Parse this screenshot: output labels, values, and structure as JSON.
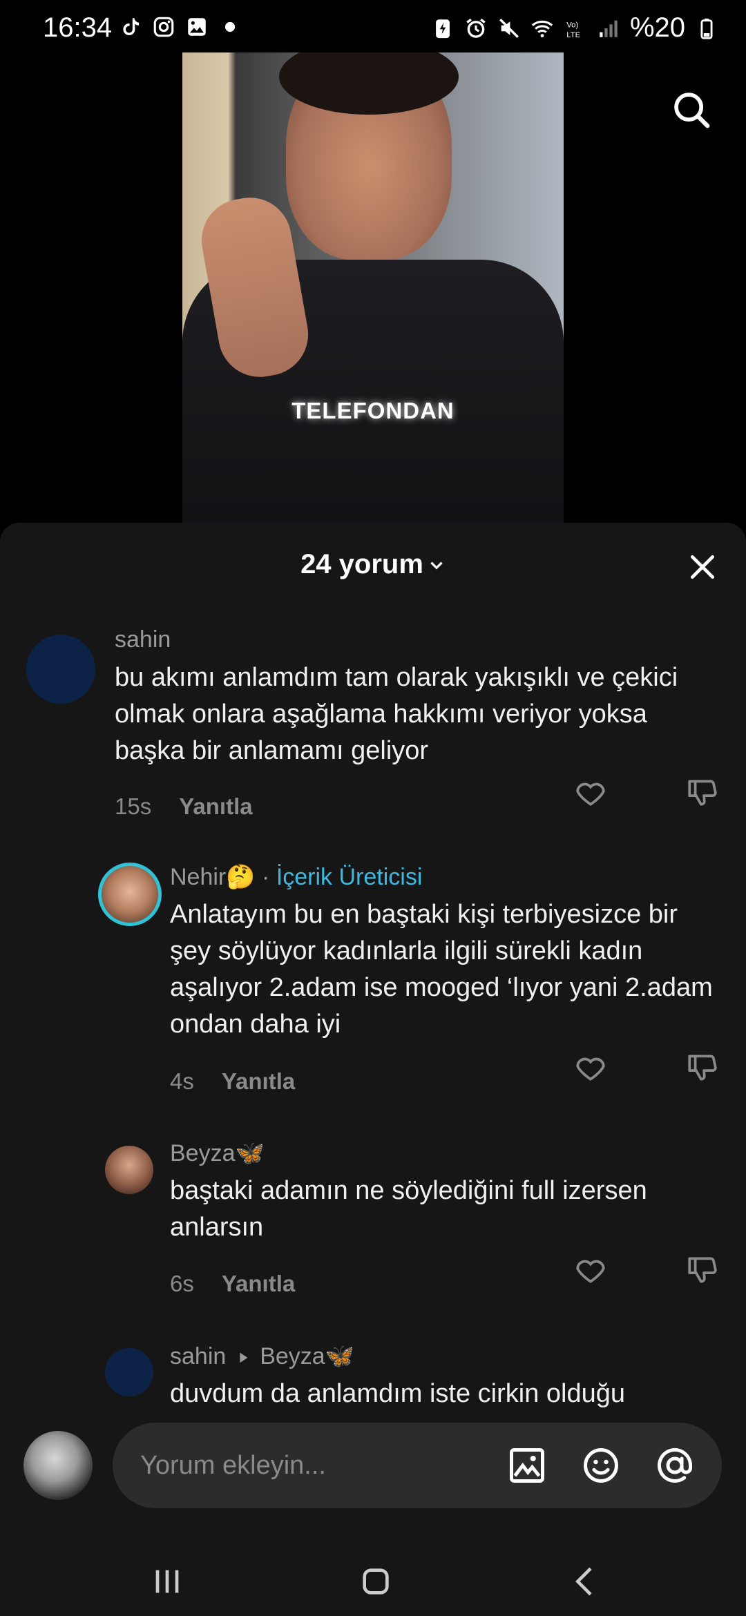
{
  "status_bar": {
    "time": "16:34",
    "battery": "%20",
    "left_icons": [
      "tiktok-icon",
      "instagram-icon",
      "gallery-icon",
      "dot-icon"
    ],
    "right_icons": [
      "battery-saver-icon",
      "alarm-icon",
      "mute-icon",
      "wifi-icon",
      "volte-icon",
      "signal-icon",
      "battery-icon"
    ]
  },
  "video": {
    "caption": "TELEFONDAN"
  },
  "sheet": {
    "title": "24 yorum"
  },
  "comments": [
    {
      "user": "sahin",
      "badge": "",
      "text": "bu akımı anlamdım tam olarak yakışıklı ve çekici olmak onlara aşağlama hakkımı veriyor yoksa başka bir anlamamı geliyor",
      "time": "15s",
      "reply_label": "Yanıtla"
    },
    {
      "user": "Nehir🤔",
      "separator": " · ",
      "badge": "İçerik Üreticisi",
      "text": "Anlatayım bu en baştaki kişi terbiyesizce bir şey söylüyor kadınlarla ilgili sürekli kadın aşalıyor 2.adam ise mooged ‘lıyor yani 2.adam ondan daha iyi",
      "time": "4s",
      "reply_label": "Yanıtla"
    },
    {
      "user": "Beyza🦋",
      "badge": "",
      "text": "baştaki adamın ne söylediğini full izersen anlarsın",
      "time": "6s",
      "reply_label": "Yanıtla"
    },
    {
      "user": "sahin",
      "reply_to": "Beyza🦋",
      "text": "duvdum da anlamdım iste cirkin olduğu"
    }
  ],
  "input": {
    "placeholder": "Yorum ekleyin..."
  },
  "colors": {
    "sheet_bg": "#161616",
    "badge": "#3fb8e0",
    "input_bg": "#2c2c2c"
  }
}
